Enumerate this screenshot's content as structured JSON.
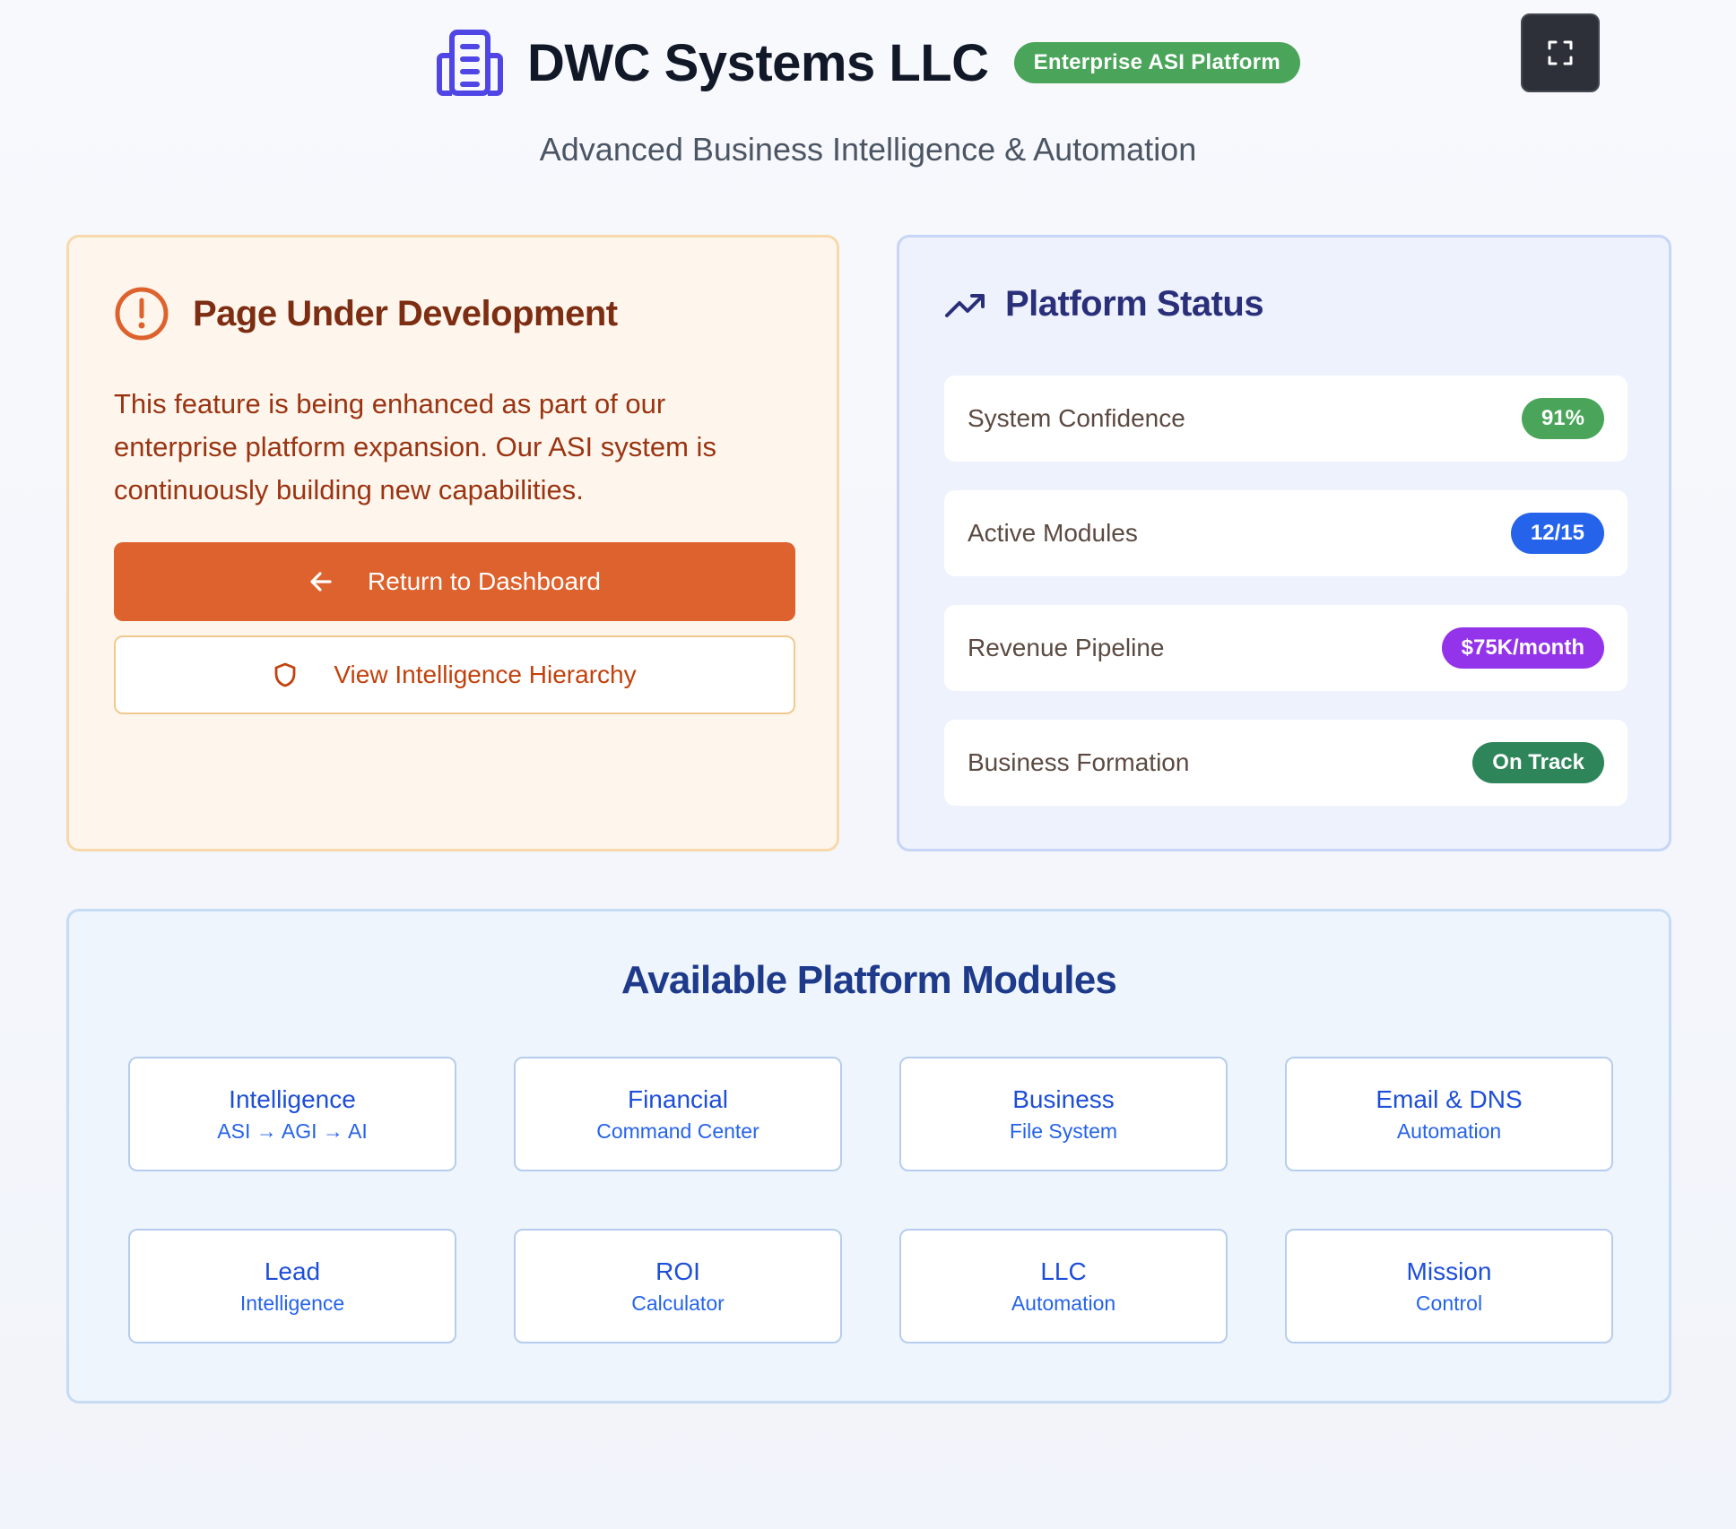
{
  "header": {
    "title": "DWC Systems LLC",
    "badge": "Enterprise ASI Platform",
    "subtitle": "Advanced Business Intelligence & Automation",
    "brand_icon": "building-icon",
    "fullscreen_icon": "fullscreen-icon"
  },
  "dev_card": {
    "icon": "alert-circle-icon",
    "title": "Page Under Development",
    "text": "This feature is being enhanced as part of our enterprise platform expansion. Our ASI system is continuously building new capabilities.",
    "primary_button": {
      "label": "Return to Dashboard",
      "icon": "arrow-left-icon"
    },
    "secondary_button": {
      "label": "View Intelligence Hierarchy",
      "icon": "shield-icon"
    }
  },
  "status": {
    "icon": "trending-up-icon",
    "title": "Platform Status",
    "rows": [
      {
        "label": "System Confidence",
        "value": "91%",
        "color": "#4aa55a"
      },
      {
        "label": "Active Modules",
        "value": "12/15",
        "color": "#2563eb"
      },
      {
        "label": "Revenue Pipeline",
        "value": "$75K/month",
        "color": "#9333ea"
      },
      {
        "label": "Business Formation",
        "value": "On Track",
        "color": "#2f855a"
      }
    ]
  },
  "modules": {
    "title": "Available Platform Modules",
    "items": [
      {
        "title": "Intelligence",
        "sub": "ASI → AGI → AI"
      },
      {
        "title": "Financial",
        "sub": "Command Center"
      },
      {
        "title": "Business",
        "sub": "File System"
      },
      {
        "title": "Email & DNS",
        "sub": "Automation"
      },
      {
        "title": "Lead",
        "sub": "Intelligence"
      },
      {
        "title": "ROI",
        "sub": "Calculator"
      },
      {
        "title": "LLC",
        "sub": "Automation"
      },
      {
        "title": "Mission",
        "sub": "Control"
      }
    ]
  },
  "colors": {
    "accent_orange": "#dd622d",
    "accent_blue": "#1d4ed8",
    "badge_green": "#4aa55a"
  }
}
